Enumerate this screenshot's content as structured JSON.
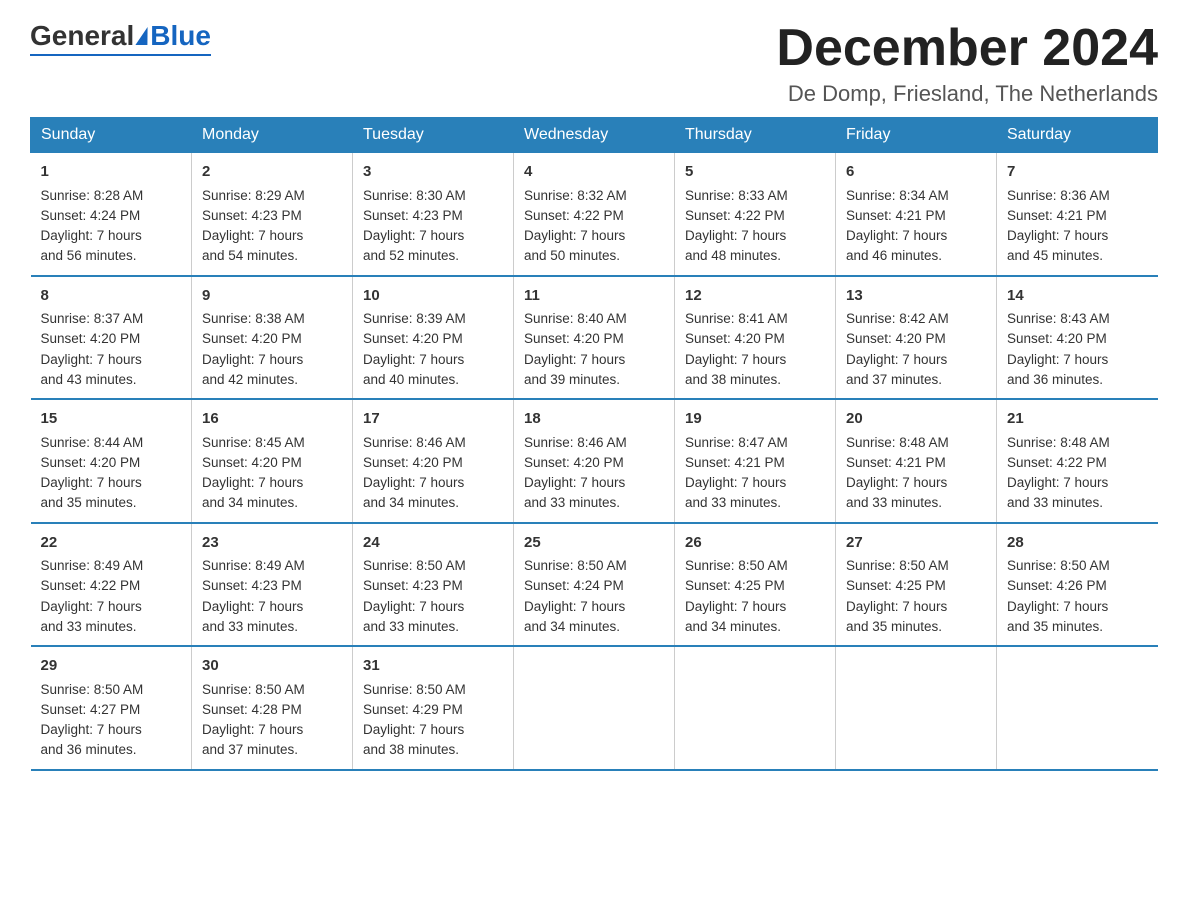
{
  "header": {
    "logo_general": "General",
    "logo_blue": "Blue",
    "month_title": "December 2024",
    "location": "De Domp, Friesland, The Netherlands"
  },
  "days_of_week": [
    "Sunday",
    "Monday",
    "Tuesday",
    "Wednesday",
    "Thursday",
    "Friday",
    "Saturday"
  ],
  "weeks": [
    [
      {
        "day": "1",
        "sunrise": "Sunrise: 8:28 AM",
        "sunset": "Sunset: 4:24 PM",
        "daylight": "Daylight: 7 hours",
        "minutes": "and 56 minutes."
      },
      {
        "day": "2",
        "sunrise": "Sunrise: 8:29 AM",
        "sunset": "Sunset: 4:23 PM",
        "daylight": "Daylight: 7 hours",
        "minutes": "and 54 minutes."
      },
      {
        "day": "3",
        "sunrise": "Sunrise: 8:30 AM",
        "sunset": "Sunset: 4:23 PM",
        "daylight": "Daylight: 7 hours",
        "minutes": "and 52 minutes."
      },
      {
        "day": "4",
        "sunrise": "Sunrise: 8:32 AM",
        "sunset": "Sunset: 4:22 PM",
        "daylight": "Daylight: 7 hours",
        "minutes": "and 50 minutes."
      },
      {
        "day": "5",
        "sunrise": "Sunrise: 8:33 AM",
        "sunset": "Sunset: 4:22 PM",
        "daylight": "Daylight: 7 hours",
        "minutes": "and 48 minutes."
      },
      {
        "day": "6",
        "sunrise": "Sunrise: 8:34 AM",
        "sunset": "Sunset: 4:21 PM",
        "daylight": "Daylight: 7 hours",
        "minutes": "and 46 minutes."
      },
      {
        "day": "7",
        "sunrise": "Sunrise: 8:36 AM",
        "sunset": "Sunset: 4:21 PM",
        "daylight": "Daylight: 7 hours",
        "minutes": "and 45 minutes."
      }
    ],
    [
      {
        "day": "8",
        "sunrise": "Sunrise: 8:37 AM",
        "sunset": "Sunset: 4:20 PM",
        "daylight": "Daylight: 7 hours",
        "minutes": "and 43 minutes."
      },
      {
        "day": "9",
        "sunrise": "Sunrise: 8:38 AM",
        "sunset": "Sunset: 4:20 PM",
        "daylight": "Daylight: 7 hours",
        "minutes": "and 42 minutes."
      },
      {
        "day": "10",
        "sunrise": "Sunrise: 8:39 AM",
        "sunset": "Sunset: 4:20 PM",
        "daylight": "Daylight: 7 hours",
        "minutes": "and 40 minutes."
      },
      {
        "day": "11",
        "sunrise": "Sunrise: 8:40 AM",
        "sunset": "Sunset: 4:20 PM",
        "daylight": "Daylight: 7 hours",
        "minutes": "and 39 minutes."
      },
      {
        "day": "12",
        "sunrise": "Sunrise: 8:41 AM",
        "sunset": "Sunset: 4:20 PM",
        "daylight": "Daylight: 7 hours",
        "minutes": "and 38 minutes."
      },
      {
        "day": "13",
        "sunrise": "Sunrise: 8:42 AM",
        "sunset": "Sunset: 4:20 PM",
        "daylight": "Daylight: 7 hours",
        "minutes": "and 37 minutes."
      },
      {
        "day": "14",
        "sunrise": "Sunrise: 8:43 AM",
        "sunset": "Sunset: 4:20 PM",
        "daylight": "Daylight: 7 hours",
        "minutes": "and 36 minutes."
      }
    ],
    [
      {
        "day": "15",
        "sunrise": "Sunrise: 8:44 AM",
        "sunset": "Sunset: 4:20 PM",
        "daylight": "Daylight: 7 hours",
        "minutes": "and 35 minutes."
      },
      {
        "day": "16",
        "sunrise": "Sunrise: 8:45 AM",
        "sunset": "Sunset: 4:20 PM",
        "daylight": "Daylight: 7 hours",
        "minutes": "and 34 minutes."
      },
      {
        "day": "17",
        "sunrise": "Sunrise: 8:46 AM",
        "sunset": "Sunset: 4:20 PM",
        "daylight": "Daylight: 7 hours",
        "minutes": "and 34 minutes."
      },
      {
        "day": "18",
        "sunrise": "Sunrise: 8:46 AM",
        "sunset": "Sunset: 4:20 PM",
        "daylight": "Daylight: 7 hours",
        "minutes": "and 33 minutes."
      },
      {
        "day": "19",
        "sunrise": "Sunrise: 8:47 AM",
        "sunset": "Sunset: 4:21 PM",
        "daylight": "Daylight: 7 hours",
        "minutes": "and 33 minutes."
      },
      {
        "day": "20",
        "sunrise": "Sunrise: 8:48 AM",
        "sunset": "Sunset: 4:21 PM",
        "daylight": "Daylight: 7 hours",
        "minutes": "and 33 minutes."
      },
      {
        "day": "21",
        "sunrise": "Sunrise: 8:48 AM",
        "sunset": "Sunset: 4:22 PM",
        "daylight": "Daylight: 7 hours",
        "minutes": "and 33 minutes."
      }
    ],
    [
      {
        "day": "22",
        "sunrise": "Sunrise: 8:49 AM",
        "sunset": "Sunset: 4:22 PM",
        "daylight": "Daylight: 7 hours",
        "minutes": "and 33 minutes."
      },
      {
        "day": "23",
        "sunrise": "Sunrise: 8:49 AM",
        "sunset": "Sunset: 4:23 PM",
        "daylight": "Daylight: 7 hours",
        "minutes": "and 33 minutes."
      },
      {
        "day": "24",
        "sunrise": "Sunrise: 8:50 AM",
        "sunset": "Sunset: 4:23 PM",
        "daylight": "Daylight: 7 hours",
        "minutes": "and 33 minutes."
      },
      {
        "day": "25",
        "sunrise": "Sunrise: 8:50 AM",
        "sunset": "Sunset: 4:24 PM",
        "daylight": "Daylight: 7 hours",
        "minutes": "and 34 minutes."
      },
      {
        "day": "26",
        "sunrise": "Sunrise: 8:50 AM",
        "sunset": "Sunset: 4:25 PM",
        "daylight": "Daylight: 7 hours",
        "minutes": "and 34 minutes."
      },
      {
        "day": "27",
        "sunrise": "Sunrise: 8:50 AM",
        "sunset": "Sunset: 4:25 PM",
        "daylight": "Daylight: 7 hours",
        "minutes": "and 35 minutes."
      },
      {
        "day": "28",
        "sunrise": "Sunrise: 8:50 AM",
        "sunset": "Sunset: 4:26 PM",
        "daylight": "Daylight: 7 hours",
        "minutes": "and 35 minutes."
      }
    ],
    [
      {
        "day": "29",
        "sunrise": "Sunrise: 8:50 AM",
        "sunset": "Sunset: 4:27 PM",
        "daylight": "Daylight: 7 hours",
        "minutes": "and 36 minutes."
      },
      {
        "day": "30",
        "sunrise": "Sunrise: 8:50 AM",
        "sunset": "Sunset: 4:28 PM",
        "daylight": "Daylight: 7 hours",
        "minutes": "and 37 minutes."
      },
      {
        "day": "31",
        "sunrise": "Sunrise: 8:50 AM",
        "sunset": "Sunset: 4:29 PM",
        "daylight": "Daylight: 7 hours",
        "minutes": "and 38 minutes."
      },
      null,
      null,
      null,
      null
    ]
  ]
}
